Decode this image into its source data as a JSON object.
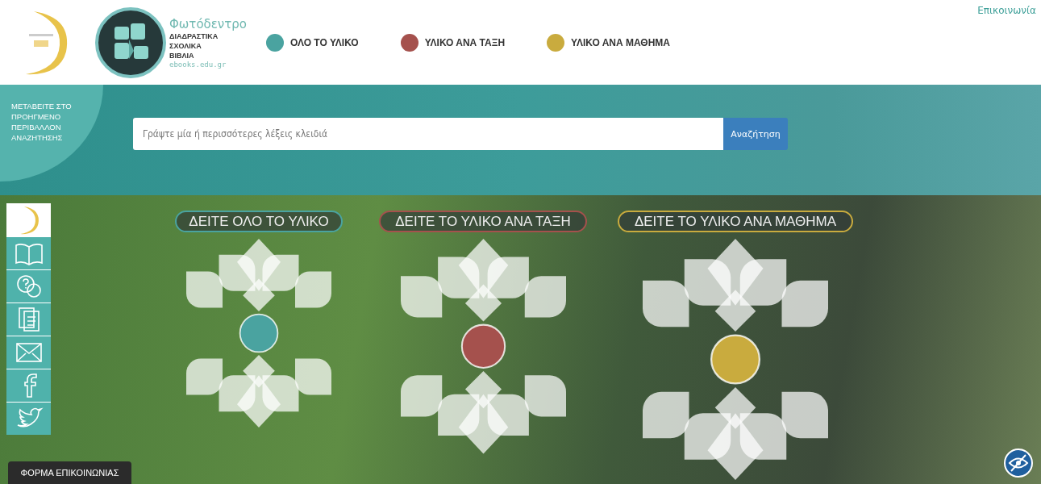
{
  "header": {
    "logo_title": "Φωτόδεντρο",
    "logo_lines": [
      "ΔΙΑΔΡΑΣΤΙΚΑ",
      "ΣΧΟΛΙΚΑ",
      "ΒΙΒΛΙΑ"
    ],
    "logo_url": "ebooks.edu.gr",
    "nav": [
      {
        "label": "ΟΛΟ ΤΟ ΥΛΙΚΟ",
        "color": "#4aa3a0"
      },
      {
        "label": "ΥΛΙΚΟ ΑΝΑ ΤΑΞΗ",
        "color": "#a5514d"
      },
      {
        "label": "ΥΛΙΚΟ ΑΝΑ ΜΑΘΗΜΑ",
        "color": "#c9ab3e"
      }
    ],
    "contact_link": "Επικοινωνία"
  },
  "search": {
    "advanced_link": "ΜΕΤΑΒΕΙΤΕ ΣΤΟ ΠΡΟΗΓΜΕΝΟ ΠΕΡΙΒΑΛΛΟΝ ΑΝΑΖΗΤΗΣΗΣ",
    "placeholder": "Γράψτε μία ή περισσότερες λέξεις κλειδιά",
    "button": "Αναζήτηση"
  },
  "sections": [
    {
      "label": "ΔΕΙΤΕ ΟΛΟ ΤΟ ΥΛΙΚΟ",
      "color": "#4aa3a0"
    },
    {
      "label": "ΔΕΙΤΕ ΤΟ ΥΛΙΚΟ ΑΝΑ ΤΑΞΗ",
      "color": "#a5514d"
    },
    {
      "label": "ΔΕΙΤΕ ΤΟ ΥΛΙΚΟ ΑΝΑ ΜΑΘΗΜΑ",
      "color": "#c9ab3e"
    }
  ],
  "contact_form": "ΦΟΡΜΑ ΕΠΙΚΟΙΝΩΝΙΑΣ"
}
